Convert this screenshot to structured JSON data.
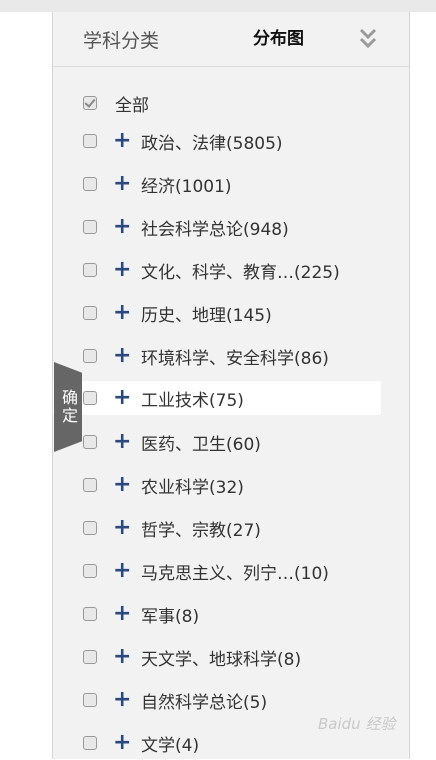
{
  "header": {
    "title": "学科分类",
    "tab_label": "分布图",
    "collapse_icon": "double-chevron-down-icon"
  },
  "all_option": {
    "label": "全部",
    "checked": true
  },
  "categories": [
    {
      "label": "政治、法律(5805)"
    },
    {
      "label": "经济(1001)"
    },
    {
      "label": "社会科学总论(948)"
    },
    {
      "label": "文化、科学、教育…(225)"
    },
    {
      "label": "历史、地理(145)"
    },
    {
      "label": "环境科学、安全科学(86)"
    },
    {
      "label": "工业技术(75)"
    },
    {
      "label": "医药、卫生(60)"
    },
    {
      "label": "农业科学(32)"
    },
    {
      "label": "哲学、宗教(27)"
    },
    {
      "label": "马克思主义、列宁…(10)"
    },
    {
      "label": "军事(8)"
    },
    {
      "label": "天文学、地球科学(8)"
    },
    {
      "label": "自然科学总论(5)"
    },
    {
      "label": "文学(4)"
    }
  ],
  "confirm_button": {
    "label": "确定"
  },
  "watermark": {
    "text": "Baidu 经验"
  },
  "colors": {
    "plus": "#2a4a7f",
    "panel_bg": "#f2f2f2",
    "confirm_bg": "#666666"
  }
}
